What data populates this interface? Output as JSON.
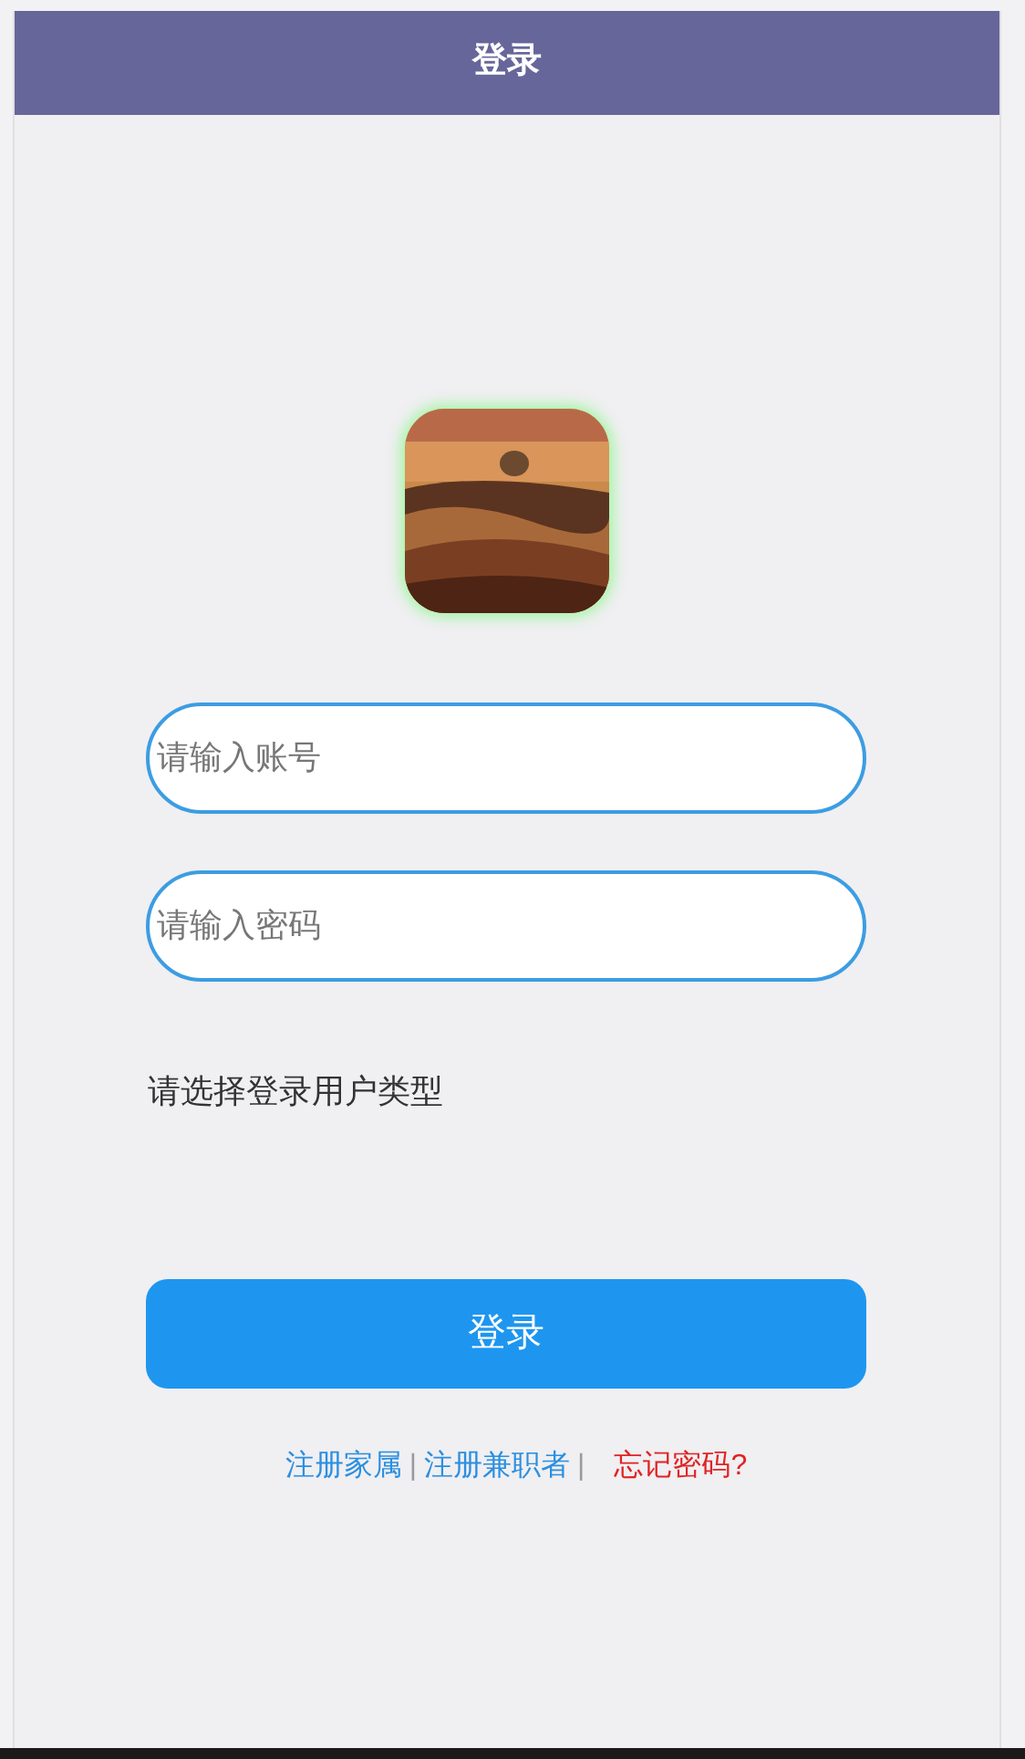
{
  "header": {
    "title": "登录"
  },
  "fields": [
    {
      "placeholder": "请输入账号"
    },
    {
      "placeholder": "请输入密码"
    }
  ],
  "user_type_label": "请选择登录用户类型",
  "login_button": "登录",
  "links": [
    {
      "text": "注册家属",
      "kind": "link"
    },
    {
      "text": "|",
      "kind": "separator"
    },
    {
      "text": "注册兼职者",
      "kind": "link"
    },
    {
      "text": "|",
      "kind": "separator"
    },
    {
      "text": "忘记密码?",
      "kind": "warning"
    }
  ]
}
